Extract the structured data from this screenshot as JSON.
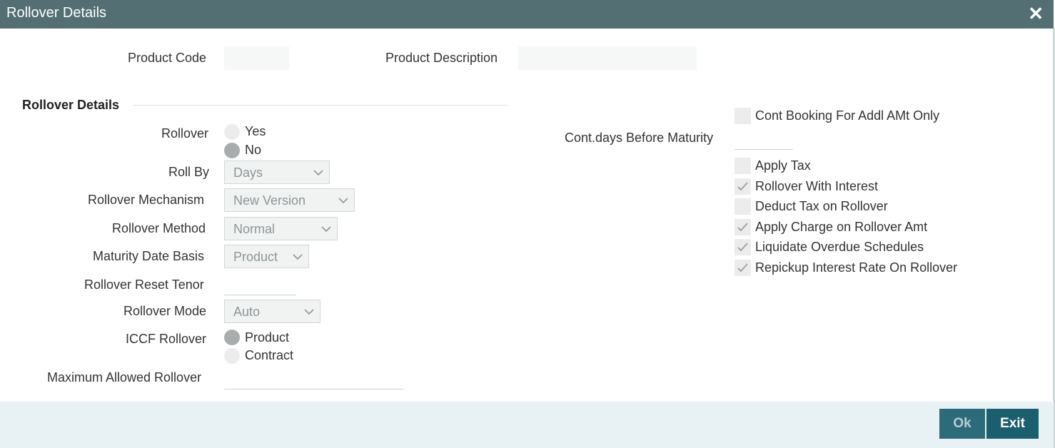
{
  "window": {
    "title": "Rollover Details",
    "close_glyph": "✕"
  },
  "header_fields": {
    "product_code_label": "Product Code",
    "product_code_value": "",
    "product_description_label": "Product Description",
    "product_description_value": ""
  },
  "section": {
    "title": "Rollover Details"
  },
  "rollover": {
    "label": "Rollover",
    "options": [
      {
        "label": "Yes",
        "selected": false
      },
      {
        "label": "No",
        "selected": true
      }
    ]
  },
  "roll_by": {
    "label": "Roll By",
    "value": "Days"
  },
  "rollover_mechanism": {
    "label": "Rollover Mechanism",
    "value": "New Version"
  },
  "rollover_method": {
    "label": "Rollover Method",
    "value": "Normal"
  },
  "maturity_date_basis": {
    "label": "Maturity Date Basis",
    "value": "Product"
  },
  "rollover_reset_tenor": {
    "label": "Rollover Reset Tenor",
    "value": ""
  },
  "rollover_mode": {
    "label": "Rollover Mode",
    "value": "Auto"
  },
  "iccf_rollover": {
    "label": "ICCF Rollover",
    "options": [
      {
        "label": "Product",
        "selected": true
      },
      {
        "label": "Contract",
        "selected": false
      }
    ]
  },
  "maximum_allowed_rollover": {
    "label": "Maximum Allowed Rollover",
    "value": ""
  },
  "right_panel": {
    "cont_booking_label": "Cont Booking For Addl AMt Only",
    "cont_booking_checked": false,
    "cont_days_label": "Cont.days Before Maturity",
    "cont_days_value": "",
    "checkboxes": [
      {
        "label": "Apply Tax",
        "checked": false
      },
      {
        "label": "Rollover With Interest",
        "checked": true
      },
      {
        "label": "Deduct Tax on Rollover",
        "checked": false
      },
      {
        "label": "Apply Charge on Rollover Amt",
        "checked": true
      },
      {
        "label": "Liquidate Overdue Schedules",
        "checked": true
      },
      {
        "label": "Repickup Interest Rate On Rollover",
        "checked": true
      }
    ]
  },
  "footer": {
    "ok_label": "Ok",
    "exit_label": "Exit"
  },
  "colors": {
    "titlebar": "#546f74",
    "button": "#1b5e6e",
    "footer": "#e8f1f3"
  }
}
